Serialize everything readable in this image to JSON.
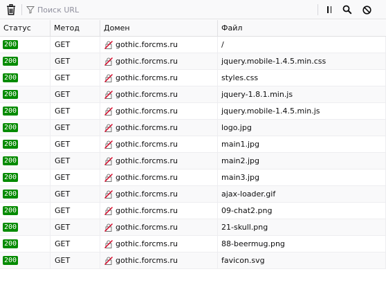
{
  "toolbar": {
    "filter_placeholder": "Поиск URL",
    "icons": {
      "clear": "trash-icon",
      "filter": "funnel-icon",
      "pause": "pause-icon",
      "search": "search-icon",
      "block": "block-icon"
    }
  },
  "columns": {
    "status": "Статус",
    "method": "Метод",
    "domain": "Домен",
    "file": "Файл"
  },
  "colors": {
    "status_ok": "#058b00",
    "insecure": "#d70022"
  },
  "requests": [
    {
      "status": "200",
      "method": "GET",
      "domain": "gothic.forcms.ru",
      "file": "/"
    },
    {
      "status": "200",
      "method": "GET",
      "domain": "gothic.forcms.ru",
      "file": "jquery.mobile-1.4.5.min.css"
    },
    {
      "status": "200",
      "method": "GET",
      "domain": "gothic.forcms.ru",
      "file": "styles.css"
    },
    {
      "status": "200",
      "method": "GET",
      "domain": "gothic.forcms.ru",
      "file": "jquery-1.8.1.min.js"
    },
    {
      "status": "200",
      "method": "GET",
      "domain": "gothic.forcms.ru",
      "file": "jquery.mobile-1.4.5.min.js"
    },
    {
      "status": "200",
      "method": "GET",
      "domain": "gothic.forcms.ru",
      "file": "logo.jpg"
    },
    {
      "status": "200",
      "method": "GET",
      "domain": "gothic.forcms.ru",
      "file": "main1.jpg"
    },
    {
      "status": "200",
      "method": "GET",
      "domain": "gothic.forcms.ru",
      "file": "main2.jpg"
    },
    {
      "status": "200",
      "method": "GET",
      "domain": "gothic.forcms.ru",
      "file": "main3.jpg"
    },
    {
      "status": "200",
      "method": "GET",
      "domain": "gothic.forcms.ru",
      "file": "ajax-loader.gif"
    },
    {
      "status": "200",
      "method": "GET",
      "domain": "gothic.forcms.ru",
      "file": "09-chat2.png"
    },
    {
      "status": "200",
      "method": "GET",
      "domain": "gothic.forcms.ru",
      "file": "21-skull.png"
    },
    {
      "status": "200",
      "method": "GET",
      "domain": "gothic.forcms.ru",
      "file": "88-beermug.png"
    },
    {
      "status": "200",
      "method": "GET",
      "domain": "gothic.forcms.ru",
      "file": "favicon.svg"
    }
  ]
}
